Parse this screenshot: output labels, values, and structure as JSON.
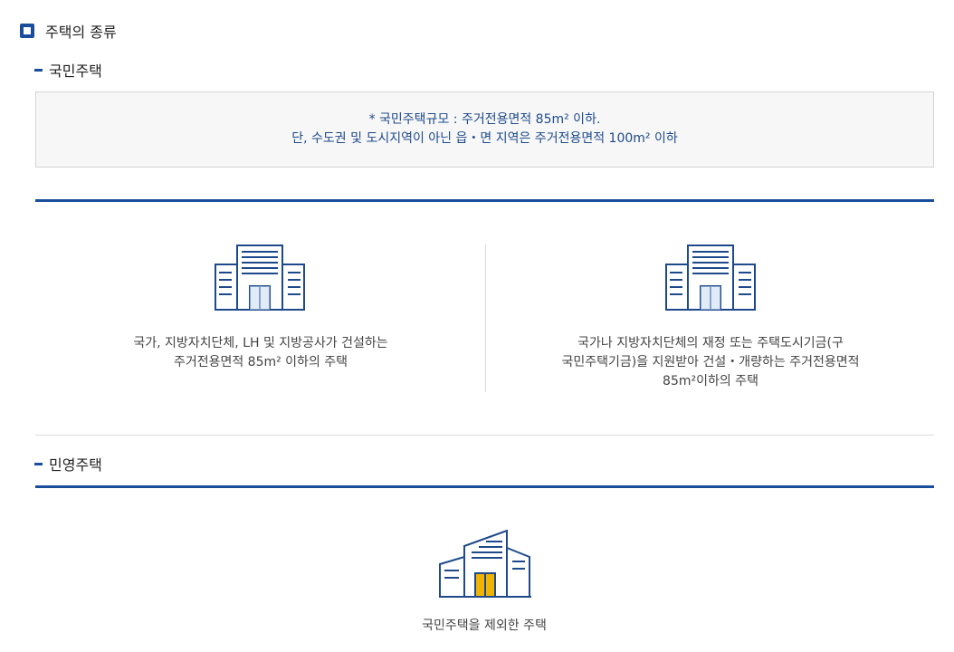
{
  "heading": "주택의 종류",
  "sections": [
    {
      "title": "국민주택",
      "notice": [
        "* 국민주택규모 : 주거전용면적 85m² 이하.",
        "단, 수도권 및 도시지역이 아닌 읍・면 지역은 주거전용면적 100m² 이하"
      ],
      "cards": [
        {
          "icon": "apartment-building-icon",
          "lines": [
            "국가, 지방자치단체, LH 및 지방공사가 건설하는",
            "주거전용면적 85m² 이하의 주택"
          ]
        },
        {
          "icon": "apartment-building-icon",
          "lines": [
            "국가나 지방자치단체의 재정 또는 주택도시기금(구",
            "국민주택기금)을 지원받아 건설・개량하는 주거전용면적",
            "85m²이하의 주택"
          ]
        }
      ]
    },
    {
      "title": "민영주택",
      "cards": [
        {
          "icon": "private-building-icon",
          "lines": [
            "국민주택을 제외한 주택"
          ]
        }
      ]
    }
  ],
  "colors": {
    "primary": "#1a4e9c",
    "icon_line": "#1e4a8c",
    "door_yellow": "#f0b400",
    "notice_bg": "#f7f7f7"
  }
}
